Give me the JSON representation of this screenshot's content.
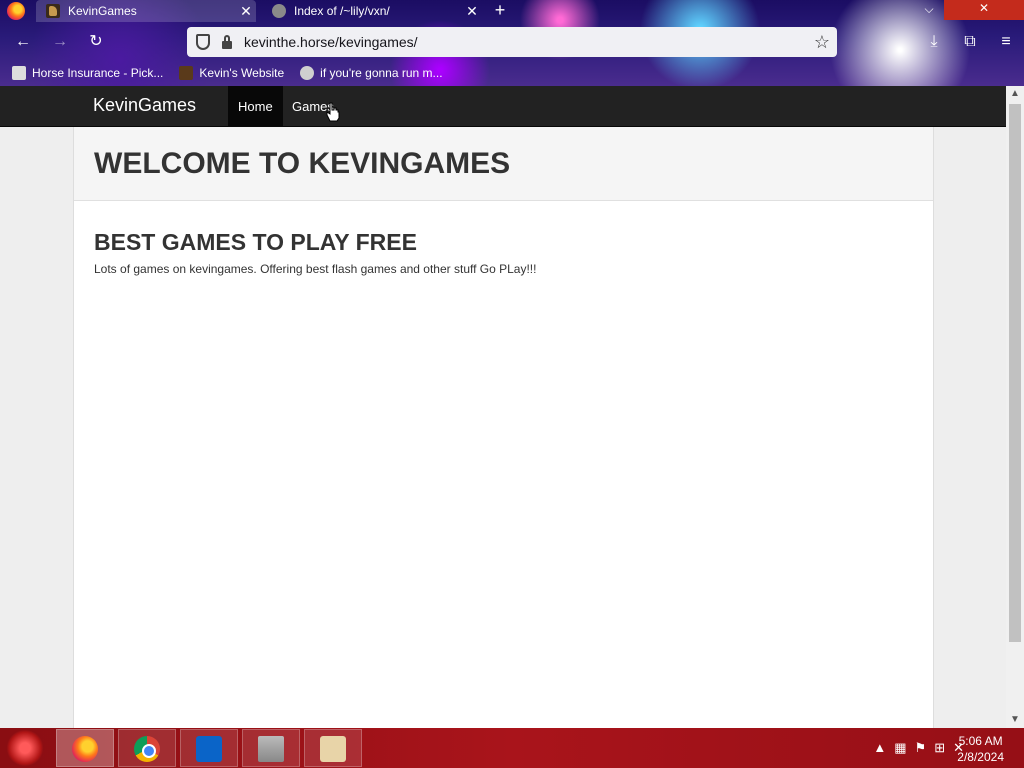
{
  "browser": {
    "tabs": [
      {
        "title": "KevinGames",
        "active": true
      },
      {
        "title": "Index of /~lily/vxn/",
        "active": false
      }
    ],
    "url": "kevinthe.horse/kevingames/",
    "bookmarks": [
      {
        "label": "Horse Insurance - Pick..."
      },
      {
        "label": "Kevin's Website"
      },
      {
        "label": "if you're gonna run m..."
      }
    ]
  },
  "site": {
    "brand": "KevinGames",
    "nav": [
      {
        "label": "Home",
        "active": true
      },
      {
        "label": "Games",
        "active": false
      }
    ],
    "heading": "WELCOME TO KEVINGAMES",
    "subheading": "BEST GAMES TO PLAY FREE",
    "description": "Lots of games on kevingames. Offering best flash games and other stuff Go PLay!!!"
  },
  "taskbar": {
    "apps": [
      "firefox",
      "chrome",
      "outlook",
      "horse",
      "files"
    ],
    "time": "5:06 AM",
    "date": "2/8/2024"
  },
  "colors": {
    "navbar": "#222222",
    "taskbar": "#a9141b"
  }
}
